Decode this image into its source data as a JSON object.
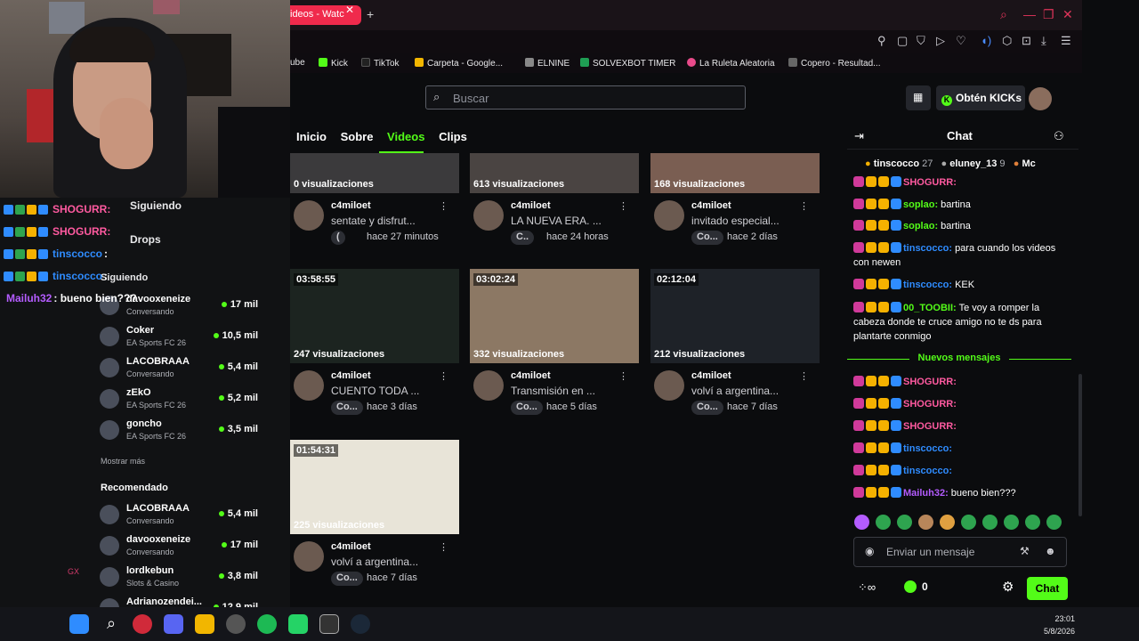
{
  "browser": {
    "tab_title": "ideos - Watc",
    "bookmarks": [
      "ube",
      "Kick",
      "TikTok",
      "Carpeta - Google...",
      "ELNINE",
      "SOLVEXBOT TIMER",
      "La Ruleta Aleatoria",
      "Copero - Resultad..."
    ]
  },
  "header": {
    "search_placeholder": "Buscar",
    "kicks_label": "Obtén KICKs"
  },
  "nav_tabs": [
    "Inicio",
    "Sobre",
    "Videos",
    "Clips"
  ],
  "overlay_chat": [
    {
      "user": "SHOGURR:",
      "color": "#ff5aa0"
    },
    {
      "user": "SHOGURR:",
      "color": "#ff5aa0"
    },
    {
      "user": "tinscocco",
      "suffix": ":",
      "color": "#2f8cff"
    },
    {
      "user": "tinscocco",
      "suffix": ":",
      "color": "#2f8cff"
    },
    {
      "user": "Mailuh32",
      "text": ": bueno bien???",
      "color": "#b45cff"
    }
  ],
  "sidebar": {
    "siguiendo": "Siguiendo",
    "drops": "Drops",
    "siguiendo2": "Siguiendo",
    "following": [
      {
        "name": "davooxeneize",
        "game": "Conversando",
        "viewers": "17 mil"
      },
      {
        "name": "Coker",
        "game": "EA Sports FC 26",
        "viewers": "10,5 mil"
      },
      {
        "name": "LACOBRAAA",
        "game": "Conversando",
        "viewers": "5,4 mil"
      },
      {
        "name": "zEkO",
        "game": "EA Sports FC 26",
        "viewers": "5,2 mil"
      },
      {
        "name": "goncho",
        "game": "EA Sports FC 26",
        "viewers": "3,5 mil"
      }
    ],
    "show_more": "Mostrar más",
    "recommended_title": "Recomendado",
    "recommended": [
      {
        "name": "LACOBRAAA",
        "game": "Conversando",
        "viewers": "5,4 mil"
      },
      {
        "name": "davooxeneize",
        "game": "Conversando",
        "viewers": "17 mil"
      },
      {
        "name": "lordkebun",
        "game": "Slots & Casino",
        "viewers": "3,8 mil"
      },
      {
        "name": "Adrianozendei...",
        "game": "",
        "viewers": "12,9 mil"
      }
    ],
    "pink_text": "GX"
  },
  "videos": [
    {
      "duration": "",
      "views": "0 visualizaciones",
      "channel": "c4miloet",
      "title": "sentate y disfrut...",
      "category": "(",
      "ago": "hace 27 minutos",
      "thumb": "#3b3a3c"
    },
    {
      "duration": "",
      "views": "613 visualizaciones",
      "channel": "c4miloet",
      "title": "LA NUEVA ERA. ...",
      "category": "C..",
      "ago": "hace 24 horas",
      "thumb": "#4a4442"
    },
    {
      "duration": "",
      "views": "168 visualizaciones",
      "channel": "c4miloet",
      "title": "invitado especial...",
      "category": "Co...",
      "ago": "hace 2 días",
      "thumb": "#7a5e52"
    },
    {
      "duration": "03:58:55",
      "views": "247 visualizaciones",
      "channel": "c4miloet",
      "title": "CUENTO TODA ...",
      "category": "Co...",
      "ago": "hace 3 días",
      "thumb": "#1c2420"
    },
    {
      "duration": "03:02:24",
      "views": "332 visualizaciones",
      "channel": "c4miloet",
      "title": "Transmisión en ...",
      "category": "Co...",
      "ago": "hace 5 días",
      "thumb": "#8c7864"
    },
    {
      "duration": "02:12:04",
      "views": "212 visualizaciones",
      "channel": "c4miloet",
      "title": "volví a argentina...",
      "category": "Co...",
      "ago": "hace 7 días",
      "thumb": "#1e2228"
    },
    {
      "duration": "01:54:31",
      "views": "225 visualizaciones",
      "channel": "c4miloet",
      "title": "volví a argentina...",
      "category": "Co...",
      "ago": "hace 7 días",
      "thumb": "#e8e4d8"
    }
  ],
  "chat": {
    "title": "Chat",
    "leaders": [
      {
        "name": "tinscocco",
        "count": "27"
      },
      {
        "name": "eluney_13",
        "count": "9"
      },
      {
        "name": "Mc",
        "count": ""
      }
    ],
    "messages": [
      {
        "user": "SHOGURR:",
        "text": "",
        "color": "#ff5aa0"
      },
      {
        "user": "soplao:",
        "text": " bartina",
        "color": "#53fc18"
      },
      {
        "user": "soplao:",
        "text": " bartina",
        "color": "#53fc18"
      },
      {
        "user": "tinscocco:",
        "text": " para cuando los videos con newen",
        "color": "#2f8cff"
      },
      {
        "user": "tinscocco:",
        "text": " KEK",
        "color": "#2f8cff"
      },
      {
        "user": "00_TOOBII:",
        "text": " Te voy a romper la cabeza donde te cruce amigo no te ds para plantarte conmigo",
        "color": "#53fc18"
      }
    ],
    "new_messages_label": "Nuevos mensajes",
    "new_messages": [
      {
        "user": "SHOGURR:",
        "text": "",
        "color": "#ff5aa0"
      },
      {
        "user": "SHOGURR:",
        "text": "",
        "color": "#ff5aa0"
      },
      {
        "user": "SHOGURR:",
        "text": "",
        "color": "#ff5aa0"
      },
      {
        "user": "tinscocco:",
        "text": "",
        "color": "#2f8cff"
      },
      {
        "user": "tinscocco:",
        "text": "",
        "color": "#2f8cff"
      },
      {
        "user": "Mailuh32:",
        "text": " bueno bien???",
        "color": "#b45cff"
      }
    ],
    "input_placeholder": "Enviar un mensaje",
    "kicks_count": "0",
    "send_label": "Chat"
  },
  "taskbar": {
    "time": "23:01",
    "date": "5/8/2026"
  }
}
